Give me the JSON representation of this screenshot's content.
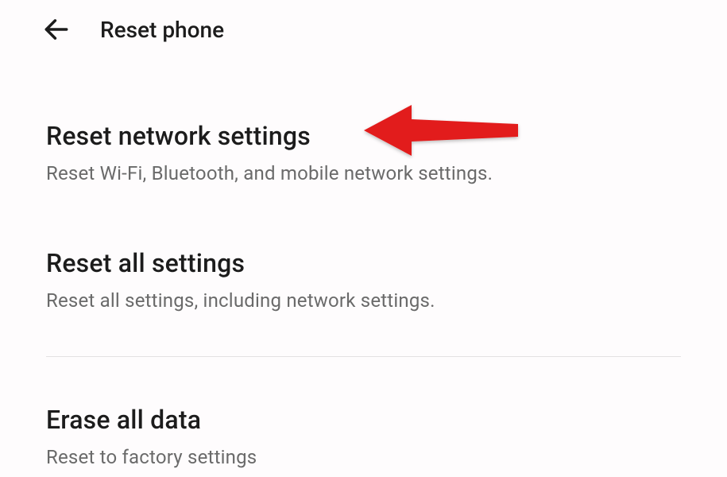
{
  "header": {
    "title": "Reset phone"
  },
  "options": [
    {
      "title": "Reset network settings",
      "subtitle": "Reset Wi-Fi, Bluetooth, and mobile network settings."
    },
    {
      "title": "Reset all settings",
      "subtitle": "Reset all settings, including network settings."
    },
    {
      "title": "Erase all data",
      "subtitle": "Reset to factory settings"
    }
  ]
}
